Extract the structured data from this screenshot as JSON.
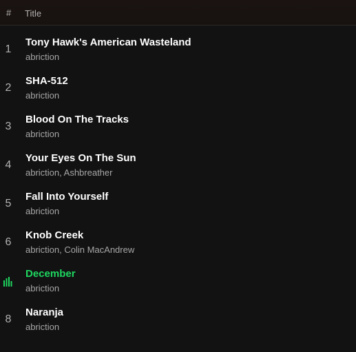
{
  "header": {
    "hash": "#",
    "title": "Title"
  },
  "colors": {
    "background": "#121212",
    "text_primary": "#ffffff",
    "text_secondary": "#a7a7a7",
    "playing_accent": "#1ed760"
  },
  "tracks": [
    {
      "number": "1",
      "title": "Tony Hawk's American Wasteland",
      "artists": "abriction",
      "playing": false
    },
    {
      "number": "2",
      "title": "SHA-512",
      "artists": "abriction",
      "playing": false
    },
    {
      "number": "3",
      "title": "Blood On The Tracks",
      "artists": "abriction",
      "playing": false
    },
    {
      "number": "4",
      "title": "Your Eyes On The Sun",
      "artists": "abriction, Ashbreather",
      "playing": false
    },
    {
      "number": "5",
      "title": "Fall Into Yourself",
      "artists": "abriction",
      "playing": false
    },
    {
      "number": "6",
      "title": "Knob Creek",
      "artists": "abriction, Colin MacAndrew",
      "playing": false
    },
    {
      "number": "7",
      "title": "December",
      "artists": "abriction",
      "playing": true,
      "icon": "equalizer-icon"
    },
    {
      "number": "8",
      "title": "Naranja",
      "artists": "abriction",
      "playing": false
    }
  ]
}
